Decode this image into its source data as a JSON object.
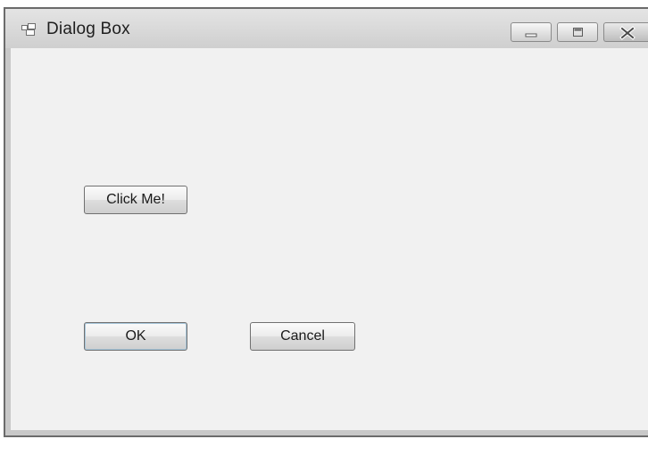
{
  "window": {
    "title": "Dialog Box",
    "icons": {
      "app": "window-app-icon",
      "minimize": "minimize-icon",
      "maximize": "maximize-icon",
      "close": "close-icon"
    }
  },
  "content": {
    "click_me_label": "Click Me!",
    "ok_label": "OK",
    "cancel_label": "Cancel"
  }
}
